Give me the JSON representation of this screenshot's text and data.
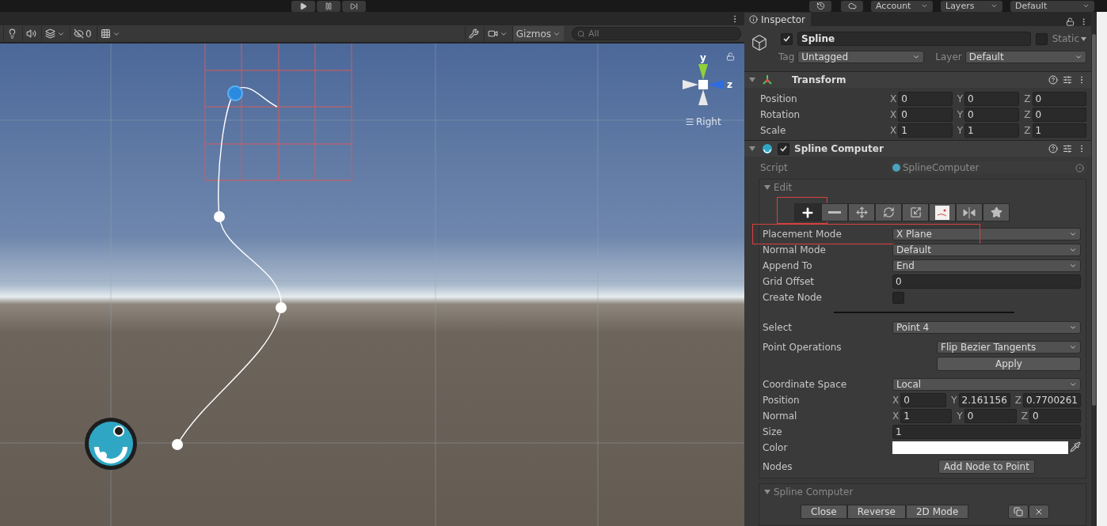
{
  "top_bar": {
    "menus": [
      {
        "label": "Account"
      },
      {
        "label": "Layers"
      },
      {
        "label": "Default"
      }
    ]
  },
  "scene_toolbar": {
    "hidden_count": "0",
    "gizmos": "Gizmos",
    "search": {
      "placeholder": "All"
    }
  },
  "scene": {
    "axis_labels": [
      "y",
      "z"
    ],
    "view_label": "Right"
  },
  "inspector": {
    "tab": "Inspector",
    "object": {
      "active": true,
      "name": "Spline",
      "static": false,
      "static_label": "Static",
      "tag_label": "Tag",
      "tag": "Untagged",
      "layer_label": "Layer",
      "layer": "Default"
    },
    "transform": {
      "title": "Transform",
      "expanded": true,
      "rows": [
        {
          "label": "Position",
          "values": [
            {
              "axis": "X",
              "value": "0"
            },
            {
              "axis": "Y",
              "value": "0"
            },
            {
              "axis": "Z",
              "value": "0"
            }
          ]
        },
        {
          "label": "Rotation",
          "values": [
            {
              "axis": "X",
              "value": "0"
            },
            {
              "axis": "Y",
              "value": "0"
            },
            {
              "axis": "Z",
              "value": "0"
            }
          ]
        },
        {
          "label": "Scale",
          "values": [
            {
              "axis": "X",
              "value": "1"
            },
            {
              "axis": "Y",
              "value": "1"
            },
            {
              "axis": "Z",
              "value": "1"
            }
          ]
        }
      ]
    },
    "spline_computer": {
      "title": "Spline Computer",
      "expanded": true,
      "enabled": true,
      "script_label": "Script",
      "script": "SplineComputer",
      "edit": {
        "title": "Edit",
        "expanded": true,
        "tools": [
          {
            "kind": "add",
            "selected": true,
            "highlighted": true
          },
          {
            "kind": "remove",
            "selected": false,
            "highlighted": false
          },
          {
            "kind": "move",
            "selected": false,
            "highlighted": false
          },
          {
            "kind": "rotate",
            "selected": false,
            "highlighted": false
          },
          {
            "kind": "scale",
            "selected": false,
            "highlighted": false
          },
          {
            "kind": "normal",
            "selected": false,
            "highlighted": false
          },
          {
            "kind": "mirror",
            "selected": false,
            "highlighted": false
          },
          {
            "kind": "star",
            "selected": false,
            "highlighted": false
          }
        ],
        "fields": [
          {
            "kind": "dropdown",
            "label": "Placement Mode",
            "value": "X Plane",
            "highlighted": true
          },
          {
            "kind": "dropdown",
            "label": "Normal Mode",
            "value": "Default",
            "highlighted": false
          },
          {
            "kind": "dropdown",
            "label": "Append To",
            "value": "End",
            "highlighted": false
          },
          {
            "kind": "text",
            "label": "Grid Offset",
            "value": "0"
          },
          {
            "kind": "checkbox",
            "label": "Create Node",
            "checked": false
          },
          {
            "kind": "separator"
          },
          {
            "kind": "dropdown",
            "label": "Select",
            "value": "Point 4",
            "highlighted": false
          },
          {
            "kind": "operation",
            "label": "Point Operations",
            "value": "Flip Bezier Tangents",
            "button": "Apply"
          },
          {
            "kind": "dropdown",
            "label": "Coordinate Space",
            "value": "Local",
            "highlighted": false
          },
          {
            "kind": "vector",
            "label": "Position",
            "values": [
              {
                "axis": "X",
                "value": "0"
              },
              {
                "axis": "Y",
                "value": "2.161156"
              },
              {
                "axis": "Z",
                "value": "0.7700261"
              }
            ]
          },
          {
            "kind": "vector",
            "label": "Normal",
            "values": [
              {
                "axis": "X",
                "value": "1"
              },
              {
                "axis": "Y",
                "value": "0"
              },
              {
                "axis": "Z",
                "value": "0"
              }
            ]
          },
          {
            "kind": "text",
            "label": "Size",
            "value": "1"
          },
          {
            "kind": "color",
            "label": "Color",
            "color": "#ffffff"
          },
          {
            "kind": "button",
            "label": "Nodes",
            "button": "Add Node to Point"
          }
        ]
      },
      "section": {
        "title": "Spline Computer",
        "expanded": true,
        "buttons": [
          "Close",
          "Reverse",
          "2D Mode"
        ]
      }
    }
  }
}
